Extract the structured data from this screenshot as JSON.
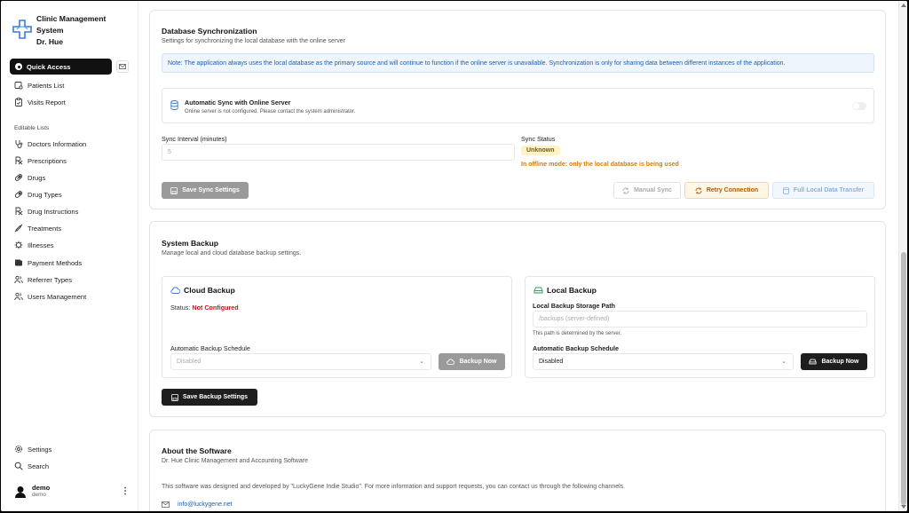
{
  "app": {
    "title_lines": [
      "Clinic Management",
      "System",
      "Dr. Hue"
    ]
  },
  "sidebar": {
    "quick_access": "Quick Access",
    "top_items": [
      {
        "label": "Patients List",
        "icon": "patients-icon"
      },
      {
        "label": "Visits Report",
        "icon": "clipboard-icon"
      }
    ],
    "section_label": "Editable Lists",
    "items": [
      {
        "label": "Doctors Information",
        "icon": "stethoscope-icon"
      },
      {
        "label": "Prescriptions",
        "icon": "rx-icon"
      },
      {
        "label": "Drugs",
        "icon": "pill-icon"
      },
      {
        "label": "Drug Types",
        "icon": "pill-icon"
      },
      {
        "label": "Drug Instructions",
        "icon": "rx-icon"
      },
      {
        "label": "Treatments",
        "icon": "syringe-icon"
      },
      {
        "label": "Illnesses",
        "icon": "virus-icon"
      },
      {
        "label": "Payment Methods",
        "icon": "wallet-icon"
      },
      {
        "label": "Referrer Types",
        "icon": "users-icon"
      },
      {
        "label": "Users Management",
        "icon": "users-icon"
      }
    ],
    "bottom_items": [
      {
        "label": "Settings",
        "icon": "gear-icon"
      },
      {
        "label": "Search",
        "icon": "search-icon"
      }
    ],
    "user": {
      "name": "demo",
      "role": "demo"
    }
  },
  "sync": {
    "title": "Database Synchronization",
    "subtitle": "Settings for synchronizing the local database with the online server",
    "note": "Note: The application always uses the local database as the primary source and will continue to function if the online server is unavailable. Synchronization is only for sharing data between different instances of the application.",
    "auto_title": "Automatic Sync with Online Server",
    "auto_desc": "Online server is not configured. Please contact the system administrator.",
    "auto_enabled": false,
    "interval_label": "Sync Interval (minutes)",
    "interval_value": "5",
    "status_label": "Sync Status",
    "status_value": "Unknown",
    "offline_msg": "In offline mode: only the local database is being used",
    "save_btn": "Save Sync Settings",
    "manual_btn": "Manual Sync",
    "retry_btn": "Retry Connection",
    "full_btn": "Full Local Data Transfer"
  },
  "backup": {
    "title": "System Backup",
    "subtitle": "Manage local and cloud database backup settings.",
    "cloud": {
      "title": "Cloud Backup",
      "status_label": "Status:",
      "status_value": "Not Configured",
      "schedule_label": "Automatic Backup Schedule",
      "schedule_value": "Disabled",
      "backup_btn": "Backup Now"
    },
    "local": {
      "title": "Local Backup",
      "path_label": "Local Backup Storage Path",
      "path_placeholder": "/backups (server-defined)",
      "path_hint": "This path is determined by the server.",
      "schedule_label": "Automatic Backup Schedule",
      "schedule_value": "Disabled",
      "backup_btn": "Backup Now"
    },
    "save_btn": "Save Backup Settings"
  },
  "about": {
    "title": "About the Software",
    "subtitle": "Dr. Hue Clinic Management and Accounting Software",
    "body": "This software was designed and developed by \"LuckyGene Indie Studio\". For more information and support requests, you can contact us through the following channels.",
    "email": "info@luckygene.net"
  }
}
